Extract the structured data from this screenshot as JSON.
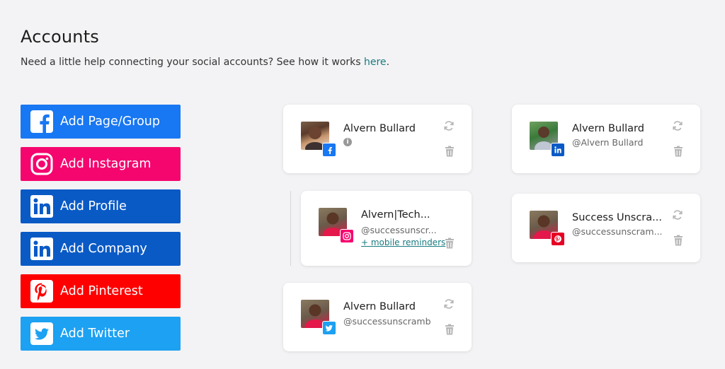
{
  "page": {
    "title": "Accounts",
    "subtitle_text": "Need a little help connecting your social accounts? See how it works ",
    "subtitle_link": "here",
    "subtitle_end": "."
  },
  "add_buttons": [
    {
      "label": "Add Page/Group",
      "icon": "facebook-icon",
      "color": "#1877f2"
    },
    {
      "label": "Add Instagram",
      "icon": "instagram-icon",
      "color": "#f5066f"
    },
    {
      "label": "Add Profile",
      "icon": "linkedin-icon",
      "color": "#0a5ac6"
    },
    {
      "label": "Add Company",
      "icon": "linkedin-icon",
      "color": "#0a5ac6"
    },
    {
      "label": "Add Pinterest",
      "icon": "pinterest-icon",
      "color": "#ff0000"
    },
    {
      "label": "Add Twitter",
      "icon": "twitter-icon",
      "color": "#1da1f2"
    }
  ],
  "accounts": [
    {
      "network": "facebook",
      "name": "Alvern Bullard",
      "handle": "",
      "info_icon": "info-icon"
    },
    {
      "network": "instagram",
      "name": "Alvern|Tech...",
      "handle": "@successunscr...",
      "reminder": "+ mobile reminders"
    },
    {
      "network": "twitter",
      "name": "Alvern Bullard",
      "handle": "@successunscramb"
    },
    {
      "network": "linkedin",
      "name": "Alvern Bullard",
      "handle": "@Alvern Bullard"
    },
    {
      "network": "pinterest",
      "name": "Success Unscra...",
      "handle": "@successunscram..."
    }
  ]
}
